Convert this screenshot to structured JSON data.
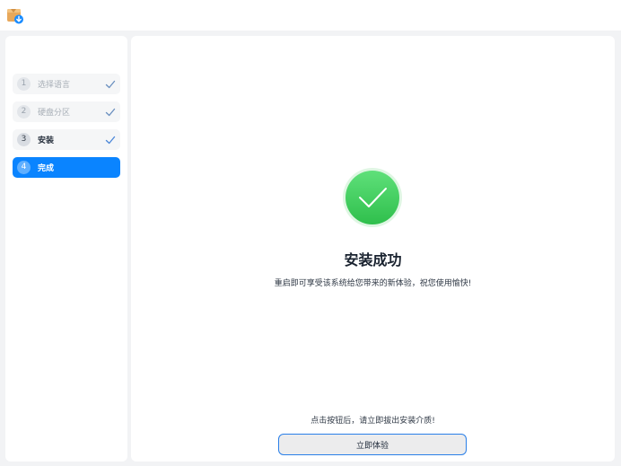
{
  "sidebar": {
    "steps": [
      {
        "number": "1",
        "label": "选择语言",
        "state": "done"
      },
      {
        "number": "2",
        "label": "硬盘分区",
        "state": "done"
      },
      {
        "number": "3",
        "label": "安装",
        "state": "done"
      },
      {
        "number": "4",
        "label": "完成",
        "state": "active"
      }
    ]
  },
  "main": {
    "title": "安装成功",
    "description": "重启即可享受该系统给您带来的新体验，祝您使用愉快!",
    "hint": "点击按钮后，请立即拔出安装介质!",
    "button_label": "立即体验"
  },
  "colors": {
    "accent": "#0a84ff",
    "success": "#3ccf5a",
    "check_mark": "#4a86d8"
  },
  "icons": {
    "app": "installer-box-download-icon",
    "step_done": "checkmark-icon",
    "success": "success-check-circle-icon"
  }
}
